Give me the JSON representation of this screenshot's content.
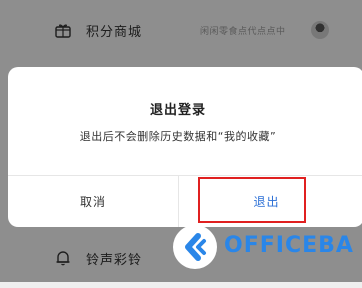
{
  "background": {
    "row_top": {
      "label": "积分商城",
      "sub": "闲闲零食点代点点中",
      "icon": "gift-icon"
    },
    "row_bottom": {
      "label": "铃声彩铃",
      "icon": "bell-icon"
    }
  },
  "dialog": {
    "title": "退出登录",
    "message": "退出后不会删除历史数据和“我的收藏”",
    "cancel_label": "取消",
    "confirm_label": "退出"
  },
  "watermark": {
    "text": "OFFICEBA"
  },
  "colors": {
    "confirm": "#2b6fd6",
    "highlight": "#e02020",
    "watermark": "#2a86e8"
  }
}
